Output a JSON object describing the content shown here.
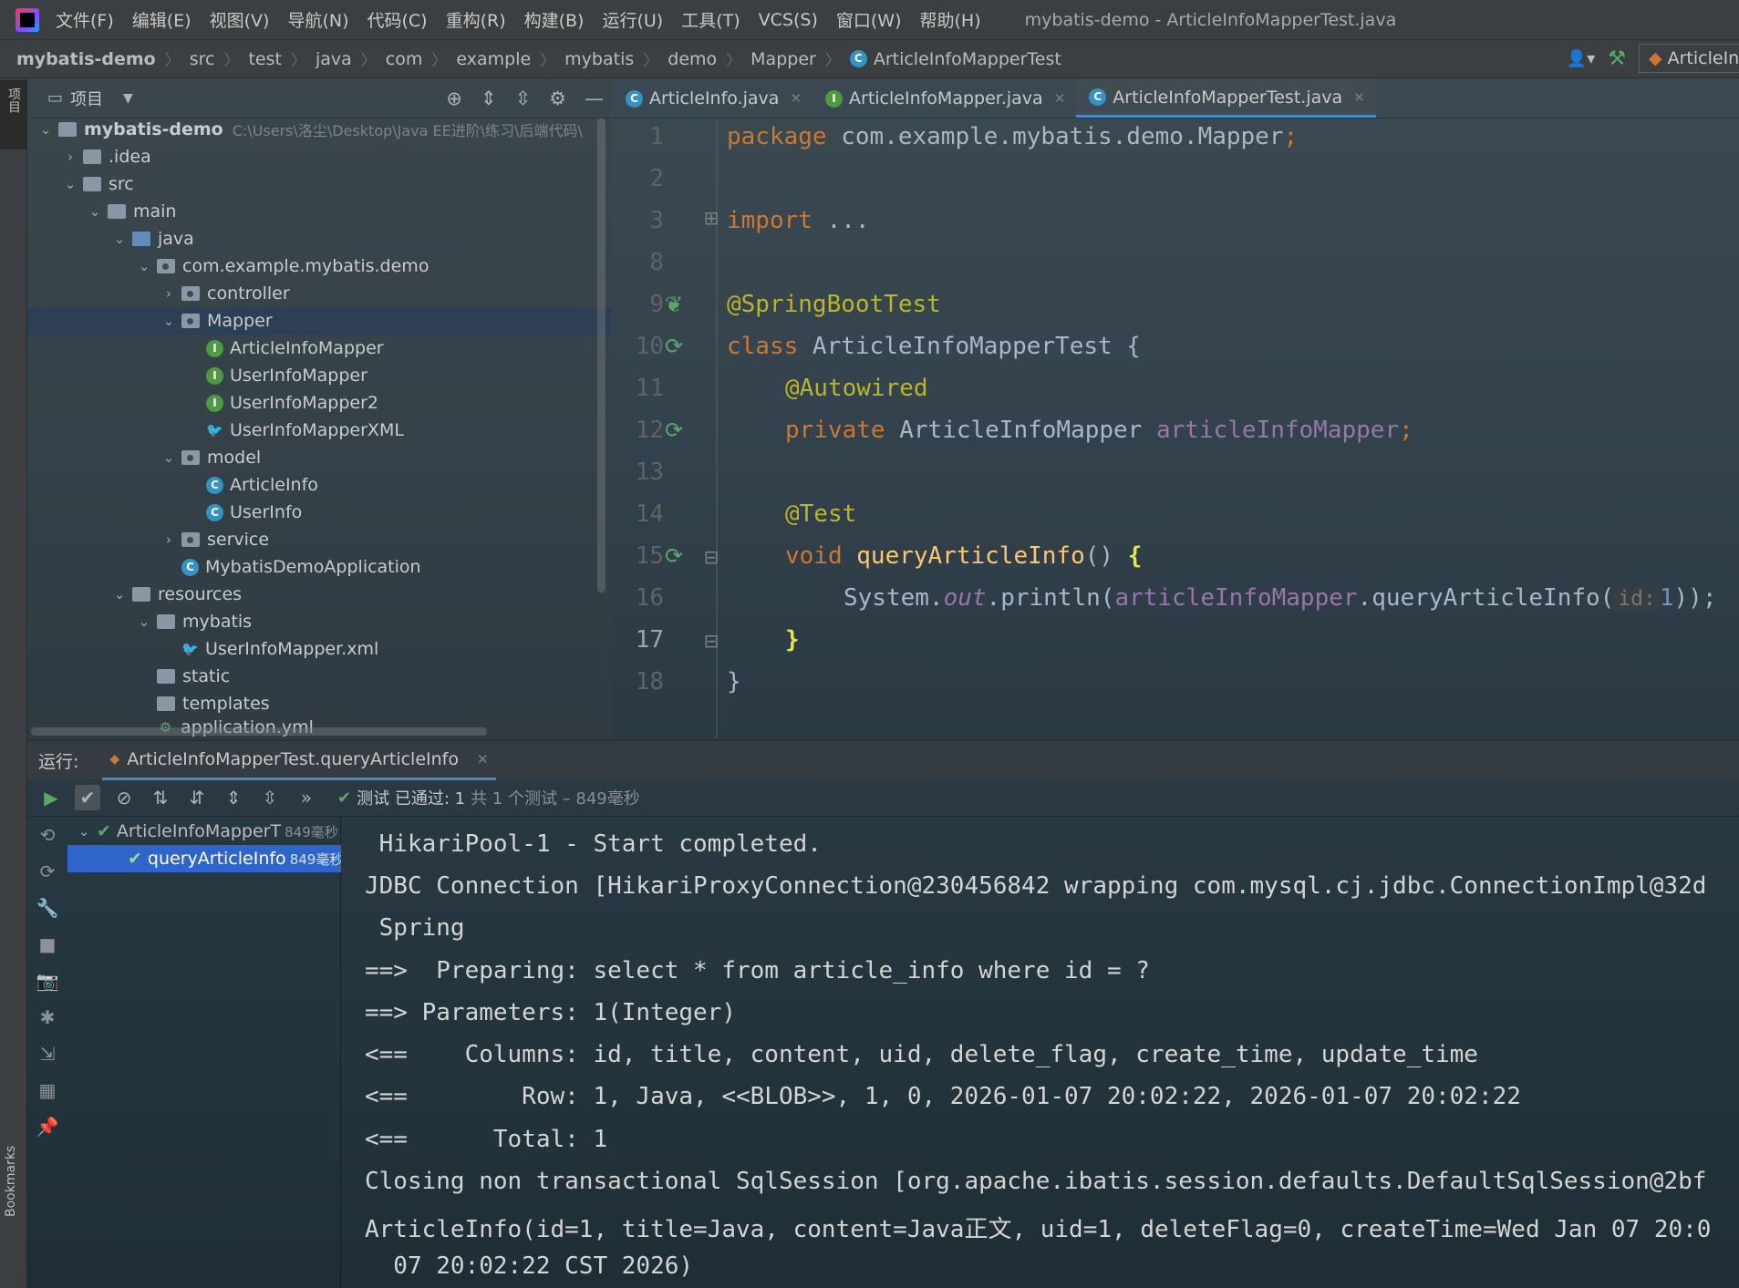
{
  "menubar": {
    "items": [
      "文件(F)",
      "编辑(E)",
      "视图(V)",
      "导航(N)",
      "代码(C)",
      "重构(R)",
      "构建(B)",
      "运行(U)",
      "工具(T)",
      "VCS(S)",
      "窗口(W)",
      "帮助(H)"
    ],
    "window_title": "mybatis-demo - ArticleInfoMapperTest.java"
  },
  "navbar": {
    "crumbs": [
      "mybatis-demo",
      "src",
      "test",
      "java",
      "com",
      "example",
      "mybatis",
      "demo",
      "Mapper",
      "ArticleInfoMapperTest"
    ],
    "run_config": "ArticleIn"
  },
  "left_stripe": {
    "project": "项目",
    "bookmarks": "Bookmarks"
  },
  "project": {
    "title": "项目",
    "root_path": "C:\\Users\\洛尘\\Desktop\\Java EE进阶\\练习\\后端代码\\",
    "tree": [
      "mybatis-demo",
      ".idea",
      "src",
      "main",
      "java",
      "com.example.mybatis.demo",
      "controller",
      "Mapper",
      "ArticleInfoMapper",
      "UserInfoMapper",
      "UserInfoMapper2",
      "UserInfoMapperXML",
      "model",
      "ArticleInfo",
      "UserInfo",
      "service",
      "MybatisDemoApplication",
      "resources",
      "mybatis",
      "UserInfoMapper.xml",
      "static",
      "templates",
      "application.yml"
    ]
  },
  "editor": {
    "tabs": [
      "ArticleInfo.java",
      "ArticleInfoMapper.java",
      "ArticleInfoMapperTest.java"
    ],
    "line_numbers": [
      "1",
      "2",
      "3",
      "8",
      "9",
      "10",
      "11",
      "12",
      "13",
      "14",
      "15",
      "16",
      "17",
      "18"
    ],
    "code": {
      "l1_kw": "package",
      "l1_rest": " com.example.mybatis.demo.Mapper",
      "l1_semi": ";",
      "l3_kw": "import",
      "l3_rest": " ...",
      "l9": "@SpringBootTest",
      "l10_kw": "class",
      "l10_rest": " ArticleInfoMapperTest {",
      "l11": "@Autowired",
      "l12_kw": "private",
      "l12_type": " ArticleInfoMapper ",
      "l12_field": "articleInfoMapper",
      "l12_semi": ";",
      "l14": "@Test",
      "l15_kw": "void",
      "l15_fn": " queryArticleInfo",
      "l15_rest": "() ",
      "l15_br": "{",
      "l16_a": "System.",
      "l16_out": "out",
      "l16_b": ".println(",
      "l16_field": "articleInfoMapper",
      "l16_c": ".queryArticleInfo(",
      "l16_hint": "id:",
      "l16_num": "1",
      "l16_d": "));",
      "l17": "}",
      "l18": "}"
    }
  },
  "run": {
    "label": "运行:",
    "tab": "ArticleInfoMapperTest.queryArticleInfo",
    "status_passed": "测试 已通过: 1",
    "status_meta": "共 1 个测试 – 849毫秒",
    "tree": [
      {
        "name": "ArticleInfoMapperT",
        "time": "849毫秒"
      },
      {
        "name": "queryArticleInfo",
        "time": "849毫秒"
      }
    ],
    "console": [
      " HikariPool-1 - Start completed.",
      "JDBC Connection [HikariProxyConnection@230456842 wrapping com.mysql.cj.jdbc.ConnectionImpl@32d",
      " Spring",
      "==>  Preparing: select * from article_info where id = ?",
      "==> Parameters: 1(Integer)",
      "<==    Columns: id, title, content, uid, delete_flag, create_time, update_time",
      "<==        Row: 1, Java, <<BLOB>>, 1, 0, 2026-01-07 20:02:22, 2026-01-07 20:02:22",
      "<==      Total: 1",
      "Closing non transactional SqlSession [org.apache.ibatis.session.defaults.DefaultSqlSession@2bf",
      "ArticleInfo(id=1, title=Java, content=Java正文, uid=1, deleteFlag=0, createTime=Wed Jan 07 20:0",
      "  07 20:02:22 CST 2026)"
    ]
  },
  "colors": {
    "accent": "#4a88c7",
    "pass": "#59a869",
    "keyword": "#cc7832",
    "annotation": "#bbb529",
    "field": "#9876aa",
    "function": "#ffc66d"
  }
}
